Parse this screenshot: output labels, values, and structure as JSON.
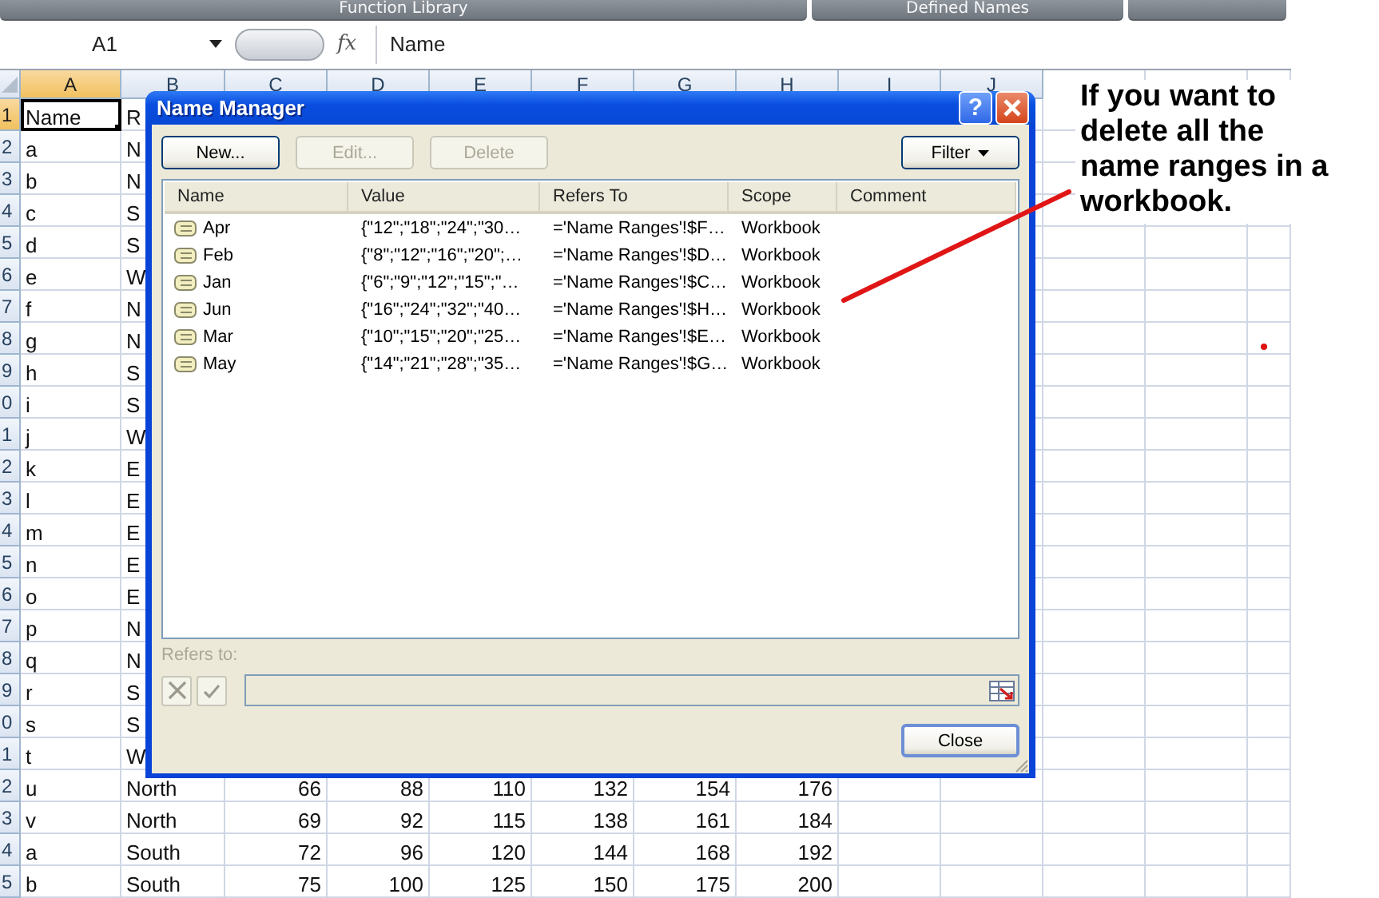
{
  "ribbon_groups": [
    "Function Library",
    "Defined Names"
  ],
  "formula_bar": {
    "name_box": "A1",
    "function_symbol": "fx",
    "formula": "Name"
  },
  "sheet": {
    "columns": [
      {
        "label": "A",
        "selected": true
      },
      {
        "label": "B",
        "selected": false
      },
      {
        "label": "C",
        "selected": false
      },
      {
        "label": "D",
        "selected": false
      },
      {
        "label": "E",
        "selected": false
      },
      {
        "label": "F",
        "selected": false
      },
      {
        "label": "G",
        "selected": false
      },
      {
        "label": "H",
        "selected": false
      },
      {
        "label": "I",
        "selected": false
      },
      {
        "label": "J",
        "selected": false
      }
    ],
    "rows": [
      {
        "number": "1",
        "selected": true,
        "cells": [
          "Name",
          "R"
        ]
      },
      {
        "number": "2",
        "selected": false,
        "cells": [
          "a",
          "N"
        ]
      },
      {
        "number": "3",
        "selected": false,
        "cells": [
          "b",
          "N"
        ]
      },
      {
        "number": "4",
        "selected": false,
        "cells": [
          "c",
          "S"
        ]
      },
      {
        "number": "5",
        "selected": false,
        "cells": [
          "d",
          "S"
        ]
      },
      {
        "number": "6",
        "selected": false,
        "cells": [
          "e",
          "W"
        ]
      },
      {
        "number": "7",
        "selected": false,
        "cells": [
          "f",
          "N"
        ]
      },
      {
        "number": "8",
        "selected": false,
        "cells": [
          "g",
          "N"
        ]
      },
      {
        "number": "9",
        "selected": false,
        "cells": [
          "h",
          "S"
        ]
      },
      {
        "number": "0",
        "selected": false,
        "cells": [
          "i",
          "S"
        ]
      },
      {
        "number": "1",
        "selected": false,
        "cells": [
          "j",
          "W"
        ]
      },
      {
        "number": "2",
        "selected": false,
        "cells": [
          "k",
          "E"
        ]
      },
      {
        "number": "3",
        "selected": false,
        "cells": [
          "l",
          "E"
        ]
      },
      {
        "number": "4",
        "selected": false,
        "cells": [
          "m",
          "E"
        ]
      },
      {
        "number": "5",
        "selected": false,
        "cells": [
          "n",
          "E"
        ]
      },
      {
        "number": "6",
        "selected": false,
        "cells": [
          "o",
          "E"
        ]
      },
      {
        "number": "7",
        "selected": false,
        "cells": [
          "p",
          "N"
        ]
      },
      {
        "number": "8",
        "selected": false,
        "cells": [
          "q",
          "N"
        ]
      },
      {
        "number": "9",
        "selected": false,
        "cells": [
          "r",
          "S"
        ]
      },
      {
        "number": "0",
        "selected": false,
        "cells": [
          "s",
          "S"
        ]
      },
      {
        "number": "1",
        "selected": false,
        "cells": [
          "t",
          "W"
        ]
      },
      {
        "number": "2",
        "selected": false,
        "cells": [
          "u",
          "North",
          "66",
          "88",
          "110",
          "132",
          "154",
          "176"
        ]
      },
      {
        "number": "3",
        "selected": false,
        "cells": [
          "v",
          "North",
          "69",
          "92",
          "115",
          "138",
          "161",
          "184"
        ]
      },
      {
        "number": "4",
        "selected": false,
        "cells": [
          "a",
          "South",
          "72",
          "96",
          "120",
          "144",
          "168",
          "192"
        ]
      },
      {
        "number": "5",
        "selected": false,
        "cells": [
          "b",
          "South",
          "75",
          "100",
          "125",
          "150",
          "175",
          "200"
        ]
      }
    ]
  },
  "dialog": {
    "title": "Name Manager",
    "help": "?",
    "buttons": [
      {
        "label": "New...",
        "disabled": false
      },
      {
        "label": "Edit...",
        "disabled": true
      },
      {
        "label": "Delete",
        "disabled": true
      }
    ],
    "filter": "Filter",
    "columns": [
      "Name",
      "Value",
      "Refers To",
      "Scope",
      "Comment"
    ],
    "names": [
      {
        "name": "Apr",
        "value": "{\"12\";\"18\";\"24\";\"30…",
        "refers_to": "='Name Ranges'!$F…",
        "scope": "Workbook"
      },
      {
        "name": "Feb",
        "value": "{\"8\";\"12\";\"16\";\"20\";…",
        "refers_to": "='Name Ranges'!$D…",
        "scope": "Workbook"
      },
      {
        "name": "Jan",
        "value": "{\"6\";\"9\";\"12\";\"15\";\"…",
        "refers_to": "='Name Ranges'!$C…",
        "scope": "Workbook"
      },
      {
        "name": "Jun",
        "value": "{\"16\";\"24\";\"32\";\"40…",
        "refers_to": "='Name Ranges'!$H…",
        "scope": "Workbook"
      },
      {
        "name": "Mar",
        "value": "{\"10\";\"15\";\"20\";\"25…",
        "refers_to": "='Name Ranges'!$E…",
        "scope": "Workbook"
      },
      {
        "name": "May",
        "value": "{\"14\";\"21\";\"28\";\"35…",
        "refers_to": "='Name Ranges'!$G…",
        "scope": "Workbook"
      }
    ],
    "refers_to": {
      "label": "Refers to:",
      "disabled": true
    },
    "close": "Close"
  },
  "callout": {
    "text": "If you want to delete all the name ranges in a workbook."
  }
}
